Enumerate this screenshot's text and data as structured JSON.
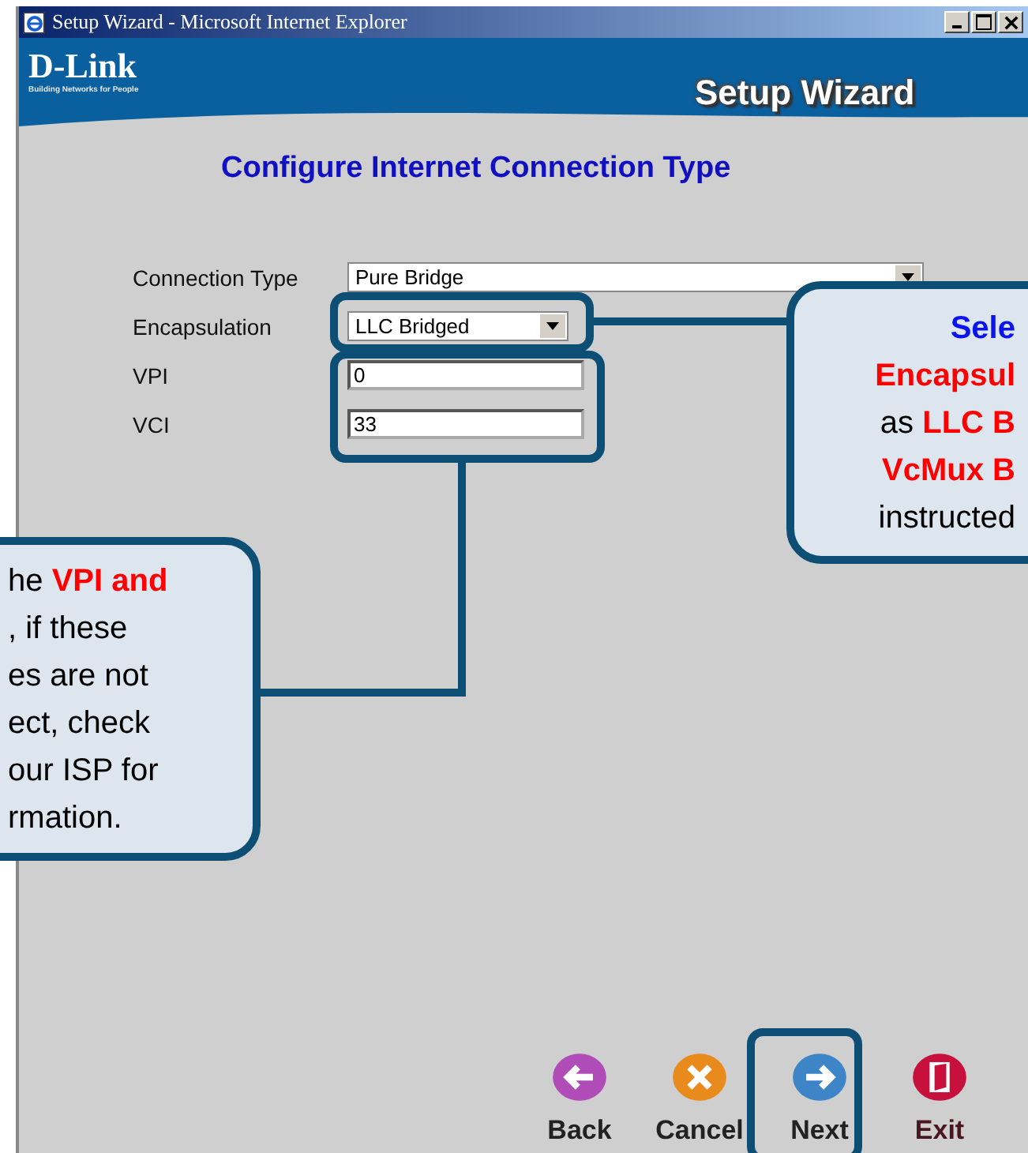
{
  "window": {
    "title": "Setup Wizard - Microsoft Internet Explorer"
  },
  "header": {
    "logo": "D-Link",
    "tagline": "Building Networks for People",
    "title": "Setup Wizard"
  },
  "page_title": "Configure Internet Connection Type",
  "form": [
    {
      "kind": "select-wide",
      "label": "Connection Type",
      "value": "Pure Bridge"
    },
    {
      "kind": "select",
      "label": "Encapsulation",
      "value": "LLC Bridged"
    },
    {
      "kind": "input",
      "label": "VPI",
      "value": "0"
    },
    {
      "kind": "input",
      "label": "VCI",
      "value": "33"
    }
  ],
  "buttons": [
    {
      "kind": "back",
      "label": "Back"
    },
    {
      "kind": "cancel",
      "label": "Cancel"
    },
    {
      "kind": "next",
      "label": "Next"
    },
    {
      "kind": "exit",
      "label": "Exit"
    }
  ],
  "callouts": [
    {
      "kind": "right",
      "lines": [
        {
          "kind": "heading",
          "text": "Sele"
        },
        {
          "kind": "highlight",
          "text": "Encapsul"
        },
        {
          "kind": "plain",
          "text": "as **LLC B**"
        },
        {
          "kind": "highlight",
          "text": "VcMux B"
        },
        {
          "kind": "plain",
          "text": "instructed"
        }
      ]
    },
    {
      "kind": "left",
      "lines": [
        {
          "kind": "plain",
          "text": "he **VPI and**"
        },
        {
          "kind": "plain",
          "text": ", if these"
        },
        {
          "kind": "plain",
          "text": "es are not"
        },
        {
          "kind": "plain",
          "text": "ect, check"
        },
        {
          "kind": "plain",
          "text": "our ISP for"
        },
        {
          "kind": "plain",
          "text": "rmation."
        }
      ]
    }
  ]
}
